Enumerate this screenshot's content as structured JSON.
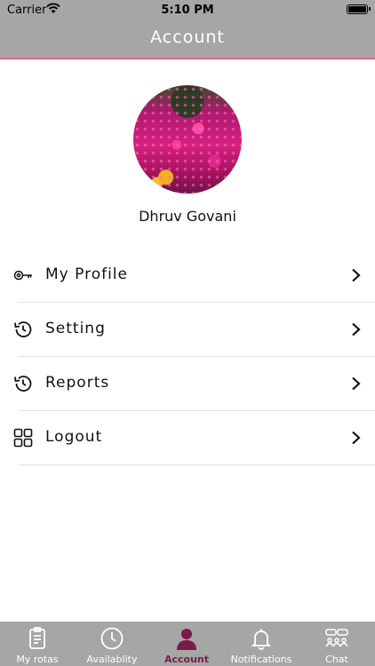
{
  "status_bar": {
    "carrier": "Carrier",
    "time": "5:10 PM"
  },
  "header": {
    "title": "Account"
  },
  "profile": {
    "name": "Dhruv Govani"
  },
  "menu": [
    {
      "label": "My Profile",
      "icon": "key-icon"
    },
    {
      "label": "Setting",
      "icon": "history-icon"
    },
    {
      "label": "Reports",
      "icon": "history-icon"
    },
    {
      "label": "Logout",
      "icon": "grid-icon"
    }
  ],
  "tabs": [
    {
      "label": "My rotas",
      "icon": "clipboard-icon",
      "active": false
    },
    {
      "label": "Availablity",
      "icon": "clock-icon",
      "active": false
    },
    {
      "label": "Account",
      "icon": "person-icon",
      "active": true
    },
    {
      "label": "Notifications",
      "icon": "bell-icon",
      "active": false
    },
    {
      "label": "Chat",
      "icon": "group-chat-icon",
      "active": false
    }
  ],
  "colors": {
    "bar": "#a6a6a6",
    "accent": "#7a1c4a",
    "header_border": "#d9668a"
  }
}
